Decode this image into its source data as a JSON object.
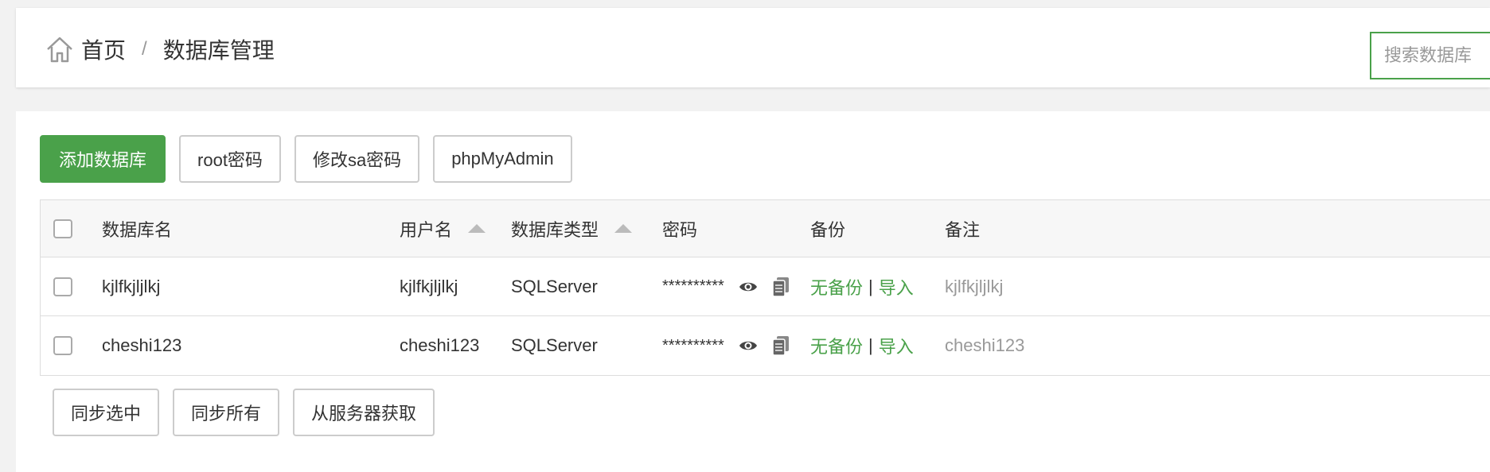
{
  "breadcrumb": {
    "home": "首页",
    "separator": "/",
    "current": "数据库管理"
  },
  "search": {
    "placeholder": "搜索数据库",
    "value": ""
  },
  "toolbar": {
    "add_database": "添加数据库",
    "root_password": "root密码",
    "change_sa_password": "修改sa密码",
    "phpmyadmin": "phpMyAdmin"
  },
  "table": {
    "headers": {
      "name": "数据库名",
      "username": "用户名",
      "type": "数据库类型",
      "password": "密码",
      "backup": "备份",
      "note": "备注"
    },
    "rows": [
      {
        "name": "kjlfkjljlkj",
        "username": "kjlfkjljlkj",
        "type": "SQLServer",
        "password": "**********",
        "backup": "无备份",
        "separator": "|",
        "import": "导入",
        "note": "kjlfkjljlkj"
      },
      {
        "name": "cheshi123",
        "username": "cheshi123",
        "type": "SQLServer",
        "password": "**********",
        "backup": "无备份",
        "separator": "|",
        "import": "导入",
        "note": "cheshi123"
      }
    ]
  },
  "footer": {
    "sync_selected": "同步选中",
    "sync_all": "同步所有",
    "fetch_from_server": "从服务器获取"
  },
  "colors": {
    "accent": "#4aa14a",
    "muted": "#999999",
    "border": "#dddddd"
  },
  "icons": {
    "home": "home-icon",
    "sort": "sort-up-icon",
    "view": "eye-icon",
    "copy": "copy-icon"
  }
}
